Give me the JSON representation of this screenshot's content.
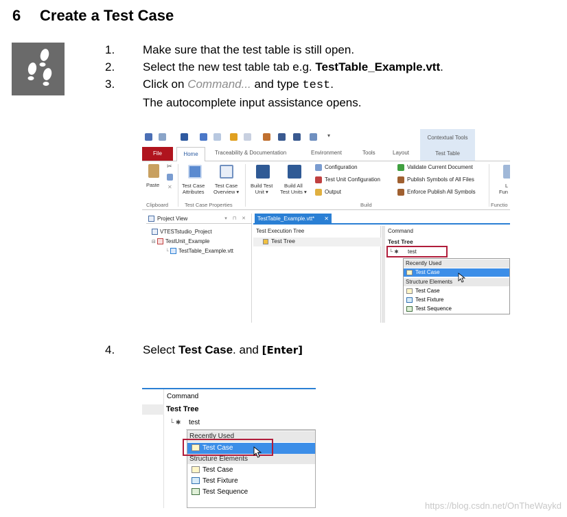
{
  "heading": {
    "number": "6",
    "title": "Create a Test Case"
  },
  "steps": [
    {
      "n": "1.",
      "text": "Make sure that the test table is still open."
    },
    {
      "n": "2.",
      "pre": "Select the new test table tab e.g. ",
      "bold": "TestTable_Example.vtt",
      "post": "."
    },
    {
      "n": "3.",
      "pre": "Click on ",
      "cmd": "Command...",
      "mid": " and type ",
      "mono": "test",
      "post": ".",
      "line2": "The autocomplete input assistance opens."
    },
    {
      "n": "4.",
      "pre": "Select ",
      "bold": "Test Case",
      "mid": ". and ",
      "bracket": "[Enter]"
    }
  ],
  "app": {
    "contextual_tools": "Contextual Tools",
    "tabs": {
      "file": "File",
      "home": "Home",
      "traceability": "Traceability & Documentation",
      "environment": "Environment",
      "tools": "Tools",
      "layout": "Layout",
      "test_table": "Test Table"
    },
    "ribbon": {
      "paste": "Paste",
      "test_case_attributes": [
        "Test Case",
        "Attributes"
      ],
      "test_case_overview": [
        "Test Case",
        "Overview ▾"
      ],
      "build_test_unit": [
        "Build Test",
        "Unit ▾"
      ],
      "build_all_test_units": [
        "Build All",
        "Test Units ▾"
      ],
      "configuration": "Configuration",
      "test_unit_configuration": "Test Unit Configuration",
      "output": "Output",
      "validate": "Validate Current Document",
      "publish_symbols": "Publish Symbols of All Files",
      "enforce_publish": "Enforce Publish All Symbols",
      "fun_partial": [
        "L",
        "Fun"
      ],
      "groups": {
        "clipboard": "Clipboard",
        "test_case_properties": "Test Case Properties",
        "build": "Build",
        "functio": "Functio"
      }
    },
    "project_view": {
      "title": "Project View",
      "controls": "▾ ⊓ ✕",
      "items": [
        "VTESTstudio_Project",
        "TestUnit_Example",
        "TestTable_Example.vtt"
      ]
    },
    "editor_tab": "TestTable_Example.vtt*",
    "editor_tab_close": "✕",
    "exec_tree": {
      "header": "Test Execution Tree",
      "row": "Test Tree"
    },
    "command": {
      "header": "Command",
      "row": "Test Tree",
      "prefix": "└ ✱",
      "input": "test",
      "recently_used": "Recently Used",
      "recent_item": "Test Case",
      "structure_elements": "Structure Elements",
      "items": [
        "Test Case",
        "Test Fixture",
        "Test Sequence"
      ]
    }
  },
  "watermark": "https://blog.csdn.net/OnTheWaykd",
  "colors": {
    "file_tab": "#b0141e",
    "highlight": "#3c8ee8",
    "red_box": "#b01c3a",
    "tab_blue": "#2a7fd4"
  }
}
